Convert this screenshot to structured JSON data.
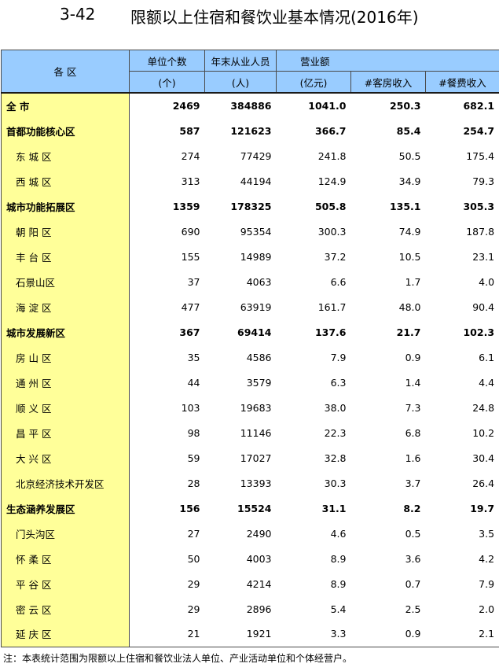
{
  "title": {
    "number": "3-42",
    "text": "限额以上住宿和餐饮业基本情况(2016年)"
  },
  "header": {
    "area": "各  区",
    "units": "单位个数",
    "units_sub": "(个)",
    "employees": "年末从业人员",
    "employees_sub": "(人)",
    "revenue": "营业额",
    "revenue_sub": "(亿元)",
    "room": "#客房收入",
    "food": "#餐费收入"
  },
  "rows": [
    {
      "name": "全      市",
      "units": "2469",
      "employees": "384886",
      "revenue": "1041.0",
      "room": "250.3",
      "food": "682.1"
    },
    {
      "name": "首都功能核心区",
      "units": "587",
      "employees": "121623",
      "revenue": "366.7",
      "room": "85.4",
      "food": "254.7"
    },
    {
      "name": "东 城 区",
      "units": "274",
      "employees": "77429",
      "revenue": "241.8",
      "room": "50.5",
      "food": "175.4"
    },
    {
      "name": "西 城 区",
      "units": "313",
      "employees": "44194",
      "revenue": "124.9",
      "room": "34.9",
      "food": "79.3"
    },
    {
      "name": "城市功能拓展区",
      "units": "1359",
      "employees": "178325",
      "revenue": "505.8",
      "room": "135.1",
      "food": "305.3"
    },
    {
      "name": "朝 阳 区",
      "units": "690",
      "employees": "95354",
      "revenue": "300.3",
      "room": "74.9",
      "food": "187.8"
    },
    {
      "name": "丰 台 区",
      "units": "155",
      "employees": "14989",
      "revenue": "37.2",
      "room": "10.5",
      "food": "23.1"
    },
    {
      "name": "石景山区",
      "units": "37",
      "employees": "4063",
      "revenue": "6.6",
      "room": "1.7",
      "food": "4.0"
    },
    {
      "name": "海 淀 区",
      "units": "477",
      "employees": "63919",
      "revenue": "161.7",
      "room": "48.0",
      "food": "90.4"
    },
    {
      "name": "城市发展新区",
      "units": "367",
      "employees": "69414",
      "revenue": "137.6",
      "room": "21.7",
      "food": "102.3"
    },
    {
      "name": "房 山 区",
      "units": "35",
      "employees": "4586",
      "revenue": "7.9",
      "room": "0.9",
      "food": "6.1"
    },
    {
      "name": "通 州 区",
      "units": "44",
      "employees": "3579",
      "revenue": "6.3",
      "room": "1.4",
      "food": "4.4"
    },
    {
      "name": "顺 义 区",
      "units": "103",
      "employees": "19683",
      "revenue": "38.0",
      "room": "7.3",
      "food": "24.8"
    },
    {
      "name": "昌 平 区",
      "units": "98",
      "employees": "11146",
      "revenue": "22.3",
      "room": "6.8",
      "food": "10.2"
    },
    {
      "name": "大 兴 区",
      "units": "59",
      "employees": "17027",
      "revenue": "32.8",
      "room": "1.6",
      "food": "30.4"
    },
    {
      "name": "北京经济技术开发区",
      "units": "28",
      "employees": "13393",
      "revenue": "30.3",
      "room": "3.7",
      "food": "26.4"
    },
    {
      "name": "生态涵养发展区",
      "units": "156",
      "employees": "15524",
      "revenue": "31.1",
      "room": "8.2",
      "food": "19.7"
    },
    {
      "name": "门头沟区",
      "units": "27",
      "employees": "2490",
      "revenue": "4.6",
      "room": "0.5",
      "food": "3.5"
    },
    {
      "name": "怀 柔 区",
      "units": "50",
      "employees": "4003",
      "revenue": "8.9",
      "room": "3.6",
      "food": "4.2"
    },
    {
      "name": "平 谷 区",
      "units": "29",
      "employees": "4214",
      "revenue": "8.9",
      "room": "0.7",
      "food": "7.9"
    },
    {
      "name": "密 云 区",
      "units": "29",
      "employees": "2896",
      "revenue": "5.4",
      "room": "2.5",
      "food": "2.0"
    },
    {
      "name": "延 庆 区",
      "units": "21",
      "employees": "1921",
      "revenue": "3.3",
      "room": "0.9",
      "food": "2.1"
    }
  ],
  "note": "注：本表统计范围为限额以上住宿和餐饮业法人单位、产业活动单位和个体经营户。",
  "colors": {
    "header_bg": "#99ccff",
    "name_bg": "#ffff99"
  }
}
